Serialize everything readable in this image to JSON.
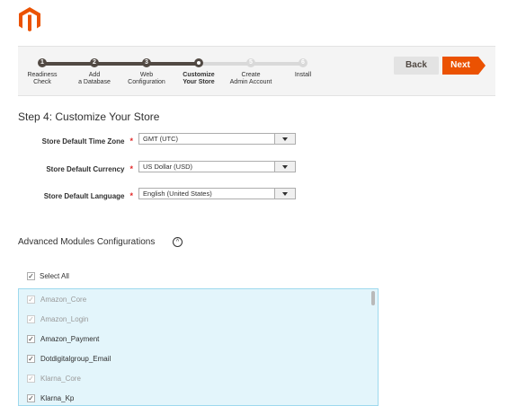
{
  "logo": {
    "name": "magento-logo",
    "color": "#eb5202"
  },
  "wizard": {
    "steps": [
      {
        "number": "1",
        "label": "Readiness\nCheck",
        "state": "done"
      },
      {
        "number": "2",
        "label": "Add\na Database",
        "state": "done"
      },
      {
        "number": "3",
        "label": "Web\nConfiguration",
        "state": "done"
      },
      {
        "number": "4",
        "label": "Customize\nYour Store",
        "state": "active"
      },
      {
        "number": "5",
        "label": "Create\nAdmin Account",
        "state": "todo"
      },
      {
        "number": "6",
        "label": "Install",
        "state": "todo"
      }
    ],
    "back_label": "Back",
    "next_label": "Next",
    "accent": "#eb5202"
  },
  "page": {
    "title": "Step 4: Customize Your Store"
  },
  "form": {
    "required_mark": "*",
    "timezone": {
      "label": "Store Default Time Zone",
      "value": "GMT (UTC)"
    },
    "currency": {
      "label": "Store Default Currency",
      "value": "US Dollar (USD)"
    },
    "language": {
      "label": "Store Default Language",
      "value": "English (United States)"
    }
  },
  "advanced": {
    "title": "Advanced Modules Configurations",
    "toggle_icon": "chevron-up-circle-icon",
    "select_all_label": "Select All",
    "select_all_checked": true,
    "modules": [
      {
        "name": "Amazon_Core",
        "checked": true,
        "disabled": true
      },
      {
        "name": "Amazon_Login",
        "checked": true,
        "disabled": true
      },
      {
        "name": "Amazon_Payment",
        "checked": true,
        "disabled": false
      },
      {
        "name": "Dotdigitalgroup_Email",
        "checked": true,
        "disabled": false
      },
      {
        "name": "Klarna_Core",
        "checked": true,
        "disabled": true
      },
      {
        "name": "Klarna_Kp",
        "checked": true,
        "disabled": false
      }
    ]
  }
}
